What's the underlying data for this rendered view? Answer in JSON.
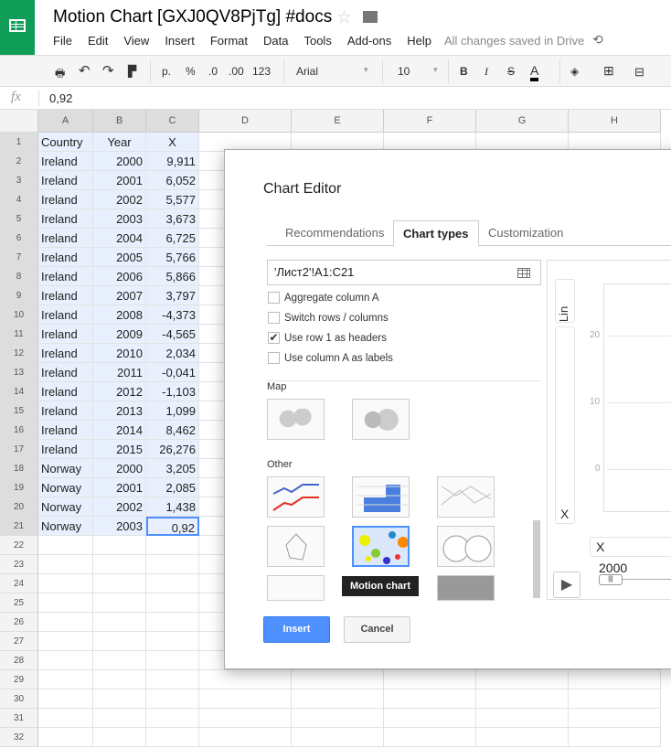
{
  "app": {
    "title": "Motion Chart [GXJ0QV8PjTg] #docs",
    "saved_status": "All changes saved in Drive",
    "menu": [
      "File",
      "Edit",
      "View",
      "Insert",
      "Format",
      "Data",
      "Tools",
      "Add-ons",
      "Help"
    ]
  },
  "toolbar": {
    "currency": "р.",
    "percent": "%",
    "dec_decrease": ".0",
    "dec_increase": ".00",
    "more_formats": "123",
    "font": "Arial",
    "font_size": "10",
    "bold": "B",
    "italic": "I",
    "strike": "S",
    "text_color": "A"
  },
  "formula": {
    "icon": "fx",
    "value": "0,92"
  },
  "columns": [
    "A",
    "B",
    "C",
    "D",
    "E",
    "F",
    "G",
    "H"
  ],
  "rows": [
    [
      "Country",
      "Year",
      "X"
    ],
    [
      "Ireland",
      "2000",
      "9,911"
    ],
    [
      "Ireland",
      "2001",
      "6,052"
    ],
    [
      "Ireland",
      "2002",
      "5,577"
    ],
    [
      "Ireland",
      "2003",
      "3,673"
    ],
    [
      "Ireland",
      "2004",
      "6,725"
    ],
    [
      "Ireland",
      "2005",
      "5,766"
    ],
    [
      "Ireland",
      "2006",
      "5,866"
    ],
    [
      "Ireland",
      "2007",
      "3,797"
    ],
    [
      "Ireland",
      "2008",
      "-4,373"
    ],
    [
      "Ireland",
      "2009",
      "-4,565"
    ],
    [
      "Ireland",
      "2010",
      "2,034"
    ],
    [
      "Ireland",
      "2011",
      "-0,041"
    ],
    [
      "Ireland",
      "2012",
      "-1,103"
    ],
    [
      "Ireland",
      "2013",
      "1,099"
    ],
    [
      "Ireland",
      "2014",
      "8,462"
    ],
    [
      "Ireland",
      "2015",
      "26,276"
    ],
    [
      "Norway",
      "2000",
      "3,205"
    ],
    [
      "Norway",
      "2001",
      "2,085"
    ],
    [
      "Norway",
      "2002",
      "1,438"
    ],
    [
      "Norway",
      "2003",
      "0,92"
    ]
  ],
  "row_count": 32,
  "dialog": {
    "title": "Chart Editor",
    "tabs": [
      "Recommendations",
      "Chart types",
      "Customization"
    ],
    "active_tab": "Chart types",
    "range": "'Лист2'!A1:C21",
    "options": [
      {
        "label": "Aggregate column A",
        "checked": false
      },
      {
        "label": "Switch rows / columns",
        "checked": false
      },
      {
        "label": "Use row 1 as headers",
        "checked": true
      },
      {
        "label": "Use column A as labels",
        "checked": false
      }
    ],
    "sections": [
      "Map",
      "Other"
    ],
    "tooltip": "Motion chart",
    "insert": "Insert",
    "cancel": "Cancel",
    "preview": {
      "scale": "Lin",
      "y_axis": "X",
      "y_ticks": [
        "20",
        "10",
        "0"
      ],
      "x_select": "X",
      "year": "2000"
    }
  },
  "colors": {
    "brand": "#0f9d58",
    "accent": "#4d90fe"
  }
}
